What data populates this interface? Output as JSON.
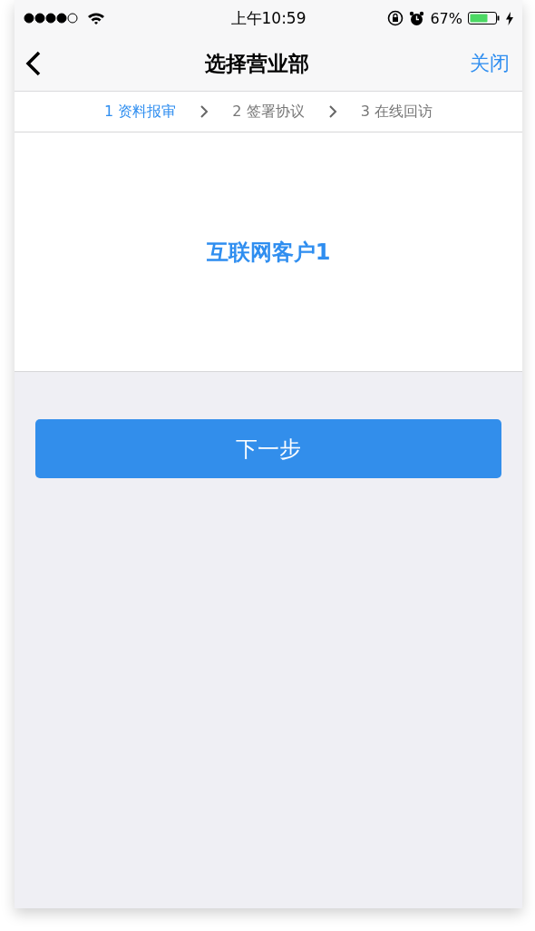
{
  "status_bar": {
    "time": "上午10:59",
    "battery_percent": "67%"
  },
  "nav_bar": {
    "title": "选择营业部",
    "close": "关闭"
  },
  "steps": [
    {
      "label": "1 资料报审",
      "selected": true
    },
    {
      "label": "2 签署协议",
      "selected": false
    },
    {
      "label": "3 在线回访",
      "selected": false
    }
  ],
  "customer": {
    "name": "互联网客户1"
  },
  "next_button": {
    "label": "下一步"
  }
}
